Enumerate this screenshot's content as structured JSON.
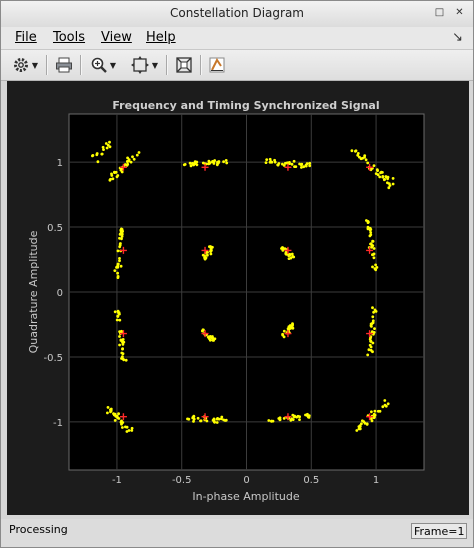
{
  "window": {
    "title": "Constellation Diagram"
  },
  "menu": {
    "file": "File",
    "tools": "Tools",
    "view": "View",
    "help": "Help"
  },
  "status": {
    "left": "Processing",
    "frame": "Frame=1"
  },
  "chart_data": {
    "type": "scatter",
    "title": "Frequency and Timing Synchronized Signal",
    "xlabel": "In-phase Amplitude",
    "ylabel": "Quadrature Amplitude",
    "xlim": [
      -1.37,
      1.37
    ],
    "ylim": [
      -1.37,
      1.37
    ],
    "xticks": [
      "-1",
      "-0.5",
      "0",
      "0.5",
      "1"
    ],
    "yticks": [
      "1",
      "0.5",
      "0",
      "-0.5",
      "-1"
    ],
    "grid": true,
    "colors": {
      "points": "#ffff00",
      "reference": "#ff2a2a",
      "axes_bg": "#000000",
      "figure_bg": "#1c1c1c",
      "text": "#c8c8c8",
      "grid": "#3c3c3c"
    },
    "reference_points": [
      [
        -0.95,
        0.96
      ],
      [
        -0.32,
        0.96
      ],
      [
        0.32,
        0.96
      ],
      [
        0.95,
        0.96
      ],
      [
        -0.95,
        0.32
      ],
      [
        -0.32,
        0.32
      ],
      [
        0.32,
        0.32
      ],
      [
        0.95,
        0.32
      ],
      [
        -0.95,
        -0.32
      ],
      [
        -0.32,
        -0.32
      ],
      [
        0.32,
        -0.32
      ],
      [
        0.95,
        -0.32
      ],
      [
        -0.95,
        -0.96
      ],
      [
        -0.32,
        -0.96
      ],
      [
        0.32,
        -0.96
      ],
      [
        0.95,
        -0.96
      ]
    ],
    "clusters": [
      {
        "center": [
          -0.95,
          0.96
        ],
        "direction": [
          0.72,
          0.69
        ],
        "spread": 0.35,
        "width": 0.04,
        "count": 30
      },
      {
        "center": [
          -1.1,
          1.1
        ],
        "direction": [
          0.72,
          0.69
        ],
        "spread": 0.25,
        "width": 0.05,
        "count": 14
      },
      {
        "center": [
          -0.32,
          0.99
        ],
        "direction": [
          1,
          0.1
        ],
        "spread": 0.35,
        "width": 0.03,
        "count": 32
      },
      {
        "center": [
          0.32,
          0.99
        ],
        "direction": [
          1,
          -0.1
        ],
        "spread": 0.35,
        "width": 0.03,
        "count": 32
      },
      {
        "center": [
          0.95,
          0.98
        ],
        "direction": [
          0.72,
          -0.69
        ],
        "spread": 0.35,
        "width": 0.04,
        "count": 30
      },
      {
        "center": [
          1.1,
          0.85
        ],
        "direction": [
          0.6,
          -0.8
        ],
        "spread": 0.14,
        "width": 0.05,
        "count": 10
      },
      {
        "center": [
          -0.98,
          0.3
        ],
        "direction": [
          0.12,
          1
        ],
        "spread": 0.38,
        "width": 0.03,
        "count": 32
      },
      {
        "center": [
          0.97,
          0.36
        ],
        "direction": [
          0.15,
          -1
        ],
        "spread": 0.4,
        "width": 0.03,
        "count": 32
      },
      {
        "center": [
          -0.97,
          -0.34
        ],
        "direction": [
          0.12,
          -1
        ],
        "spread": 0.4,
        "width": 0.03,
        "count": 32
      },
      {
        "center": [
          0.97,
          -0.3
        ],
        "direction": [
          0.1,
          1
        ],
        "spread": 0.38,
        "width": 0.03,
        "count": 32
      },
      {
        "center": [
          -0.3,
          0.3
        ],
        "direction": [
          0.45,
          0.89
        ],
        "spread": 0.12,
        "width": 0.03,
        "count": 22
      },
      {
        "center": [
          0.32,
          0.3
        ],
        "direction": [
          0.7,
          -0.71
        ],
        "spread": 0.13,
        "width": 0.03,
        "count": 22
      },
      {
        "center": [
          -0.3,
          -0.33
        ],
        "direction": [
          0.7,
          -0.71
        ],
        "spread": 0.13,
        "width": 0.03,
        "count": 22
      },
      {
        "center": [
          0.32,
          -0.3
        ],
        "direction": [
          0.7,
          0.71
        ],
        "spread": 0.13,
        "width": 0.03,
        "count": 22
      },
      {
        "center": [
          -0.98,
          -0.98
        ],
        "direction": [
          0.72,
          -0.69
        ],
        "spread": 0.28,
        "width": 0.04,
        "count": 28
      },
      {
        "center": [
          -0.3,
          -0.98
        ],
        "direction": [
          1,
          -0.05
        ],
        "spread": 0.33,
        "width": 0.03,
        "count": 30
      },
      {
        "center": [
          0.33,
          -0.97
        ],
        "direction": [
          1,
          0.12
        ],
        "spread": 0.33,
        "width": 0.03,
        "count": 30
      },
      {
        "center": [
          0.97,
          -0.96
        ],
        "direction": [
          0.72,
          0.69
        ],
        "spread": 0.33,
        "width": 0.04,
        "count": 30
      }
    ]
  }
}
